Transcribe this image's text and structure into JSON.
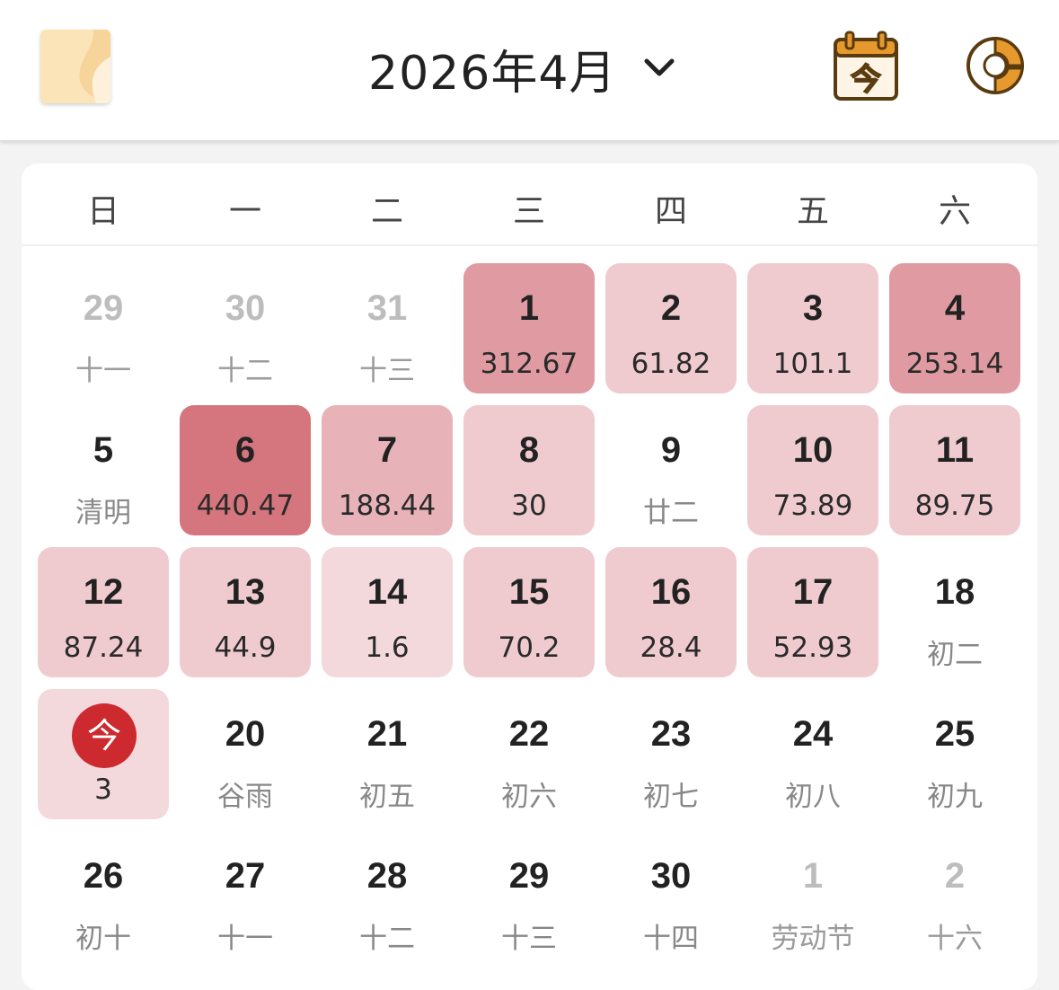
{
  "header": {
    "month_title": "2026年4月",
    "today_icon_label": "今"
  },
  "weekdays": [
    "日",
    "一",
    "二",
    "三",
    "四",
    "五",
    "六"
  ],
  "colors": {
    "intensity_1": "#f3d9dc",
    "intensity_2": "#efcbcf",
    "intensity_3": "#e7b3b8",
    "intensity_4": "#df9ba1",
    "intensity_5": "#d5757d",
    "today_badge": "#cc2a2f",
    "accent_orange": "#e69a2e"
  },
  "weeks": [
    [
      {
        "day": "29",
        "sub": "十一",
        "other_month": true
      },
      {
        "day": "30",
        "sub": "十二",
        "other_month": true
      },
      {
        "day": "31",
        "sub": "十三",
        "other_month": true
      },
      {
        "day": "1",
        "sub": "312.67",
        "value": 312.67
      },
      {
        "day": "2",
        "sub": "61.82",
        "value": 61.82
      },
      {
        "day": "3",
        "sub": "101.1",
        "value": 101.1
      },
      {
        "day": "4",
        "sub": "253.14",
        "value": 253.14
      }
    ],
    [
      {
        "day": "5",
        "sub": "清明"
      },
      {
        "day": "6",
        "sub": "440.47",
        "value": 440.47
      },
      {
        "day": "7",
        "sub": "188.44",
        "value": 188.44
      },
      {
        "day": "8",
        "sub": "30",
        "value": 30
      },
      {
        "day": "9",
        "sub": "廿二"
      },
      {
        "day": "10",
        "sub": "73.89",
        "value": 73.89
      },
      {
        "day": "11",
        "sub": "89.75",
        "value": 89.75
      }
    ],
    [
      {
        "day": "12",
        "sub": "87.24",
        "value": 87.24
      },
      {
        "day": "13",
        "sub": "44.9",
        "value": 44.9
      },
      {
        "day": "14",
        "sub": "1.6",
        "value": 1.6
      },
      {
        "day": "15",
        "sub": "70.2",
        "value": 70.2
      },
      {
        "day": "16",
        "sub": "28.4",
        "value": 28.4
      },
      {
        "day": "17",
        "sub": "52.93",
        "value": 52.93
      },
      {
        "day": "18",
        "sub": "初二"
      }
    ],
    [
      {
        "day": "今",
        "sub": "3",
        "value": 3,
        "today": true
      },
      {
        "day": "20",
        "sub": "谷雨"
      },
      {
        "day": "21",
        "sub": "初五"
      },
      {
        "day": "22",
        "sub": "初六"
      },
      {
        "day": "23",
        "sub": "初七"
      },
      {
        "day": "24",
        "sub": "初八"
      },
      {
        "day": "25",
        "sub": "初九"
      }
    ],
    [
      {
        "day": "26",
        "sub": "初十"
      },
      {
        "day": "27",
        "sub": "十一"
      },
      {
        "day": "28",
        "sub": "十二"
      },
      {
        "day": "29",
        "sub": "十三"
      },
      {
        "day": "30",
        "sub": "十四"
      },
      {
        "day": "1",
        "sub": "劳动节",
        "other_month": true
      },
      {
        "day": "2",
        "sub": "十六",
        "other_month": true
      }
    ]
  ]
}
